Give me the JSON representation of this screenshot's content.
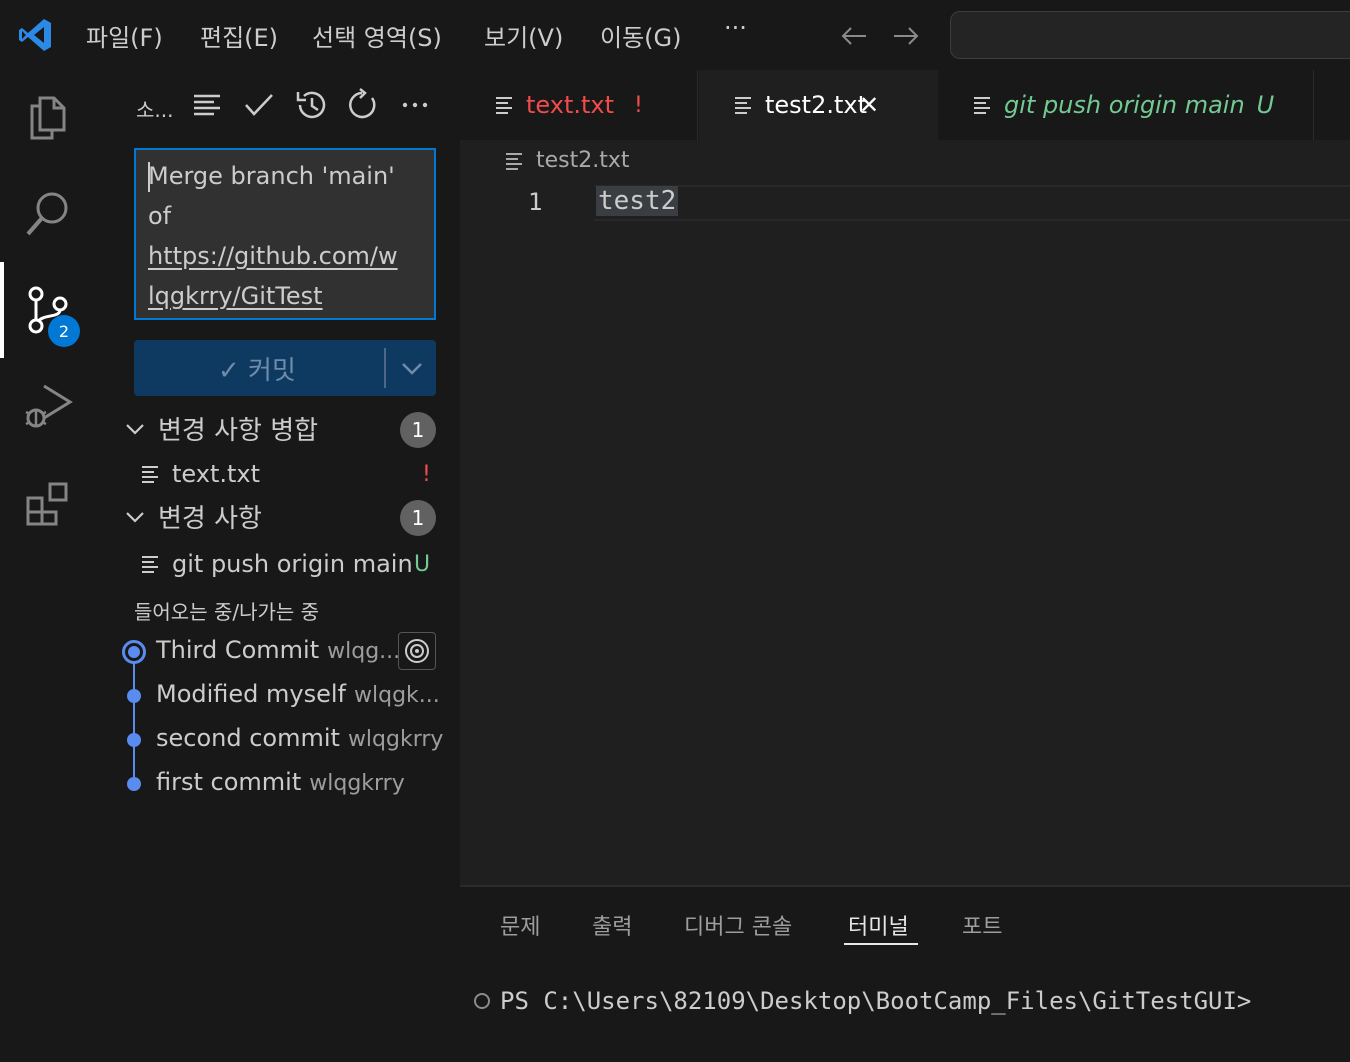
{
  "menu": {
    "items": [
      "파일(F)",
      "편집(E)",
      "선택 영역(S)",
      "보기(V)",
      "이동(G)"
    ],
    "more": "···"
  },
  "activity": {
    "scm_badge": "2"
  },
  "sidebar": {
    "title": "소...",
    "commit_message": {
      "line1": "Merge branch 'main'",
      "line2": "of",
      "line3": "https://github.com/w",
      "line4": "lqgkrry/GitTest"
    },
    "commit_button": "✓ 커밋",
    "merge_changes": {
      "label": "변경 사항 병합",
      "count": "1",
      "file": "text.txt",
      "status": "!"
    },
    "changes": {
      "label": "변경 사항",
      "count": "1",
      "file": "git push origin main",
      "status": "U"
    },
    "graph": {
      "title": "들어오는 중/나가는 중",
      "commits": [
        {
          "message": "Third Commit",
          "author": "wlqg..."
        },
        {
          "message": "Modified myself",
          "author": "wlqgk..."
        },
        {
          "message": "second commit",
          "author": "wlqgkrry"
        },
        {
          "message": "first commit",
          "author": "wlqgkrry"
        }
      ]
    }
  },
  "tabs": [
    {
      "label": "text.txt",
      "status": "!"
    },
    {
      "label": "test2.txt",
      "close": "✕"
    },
    {
      "label": "git push origin main",
      "status": "U"
    }
  ],
  "editor": {
    "breadcrumb": "test2.txt",
    "line_number": "1",
    "code": "test2"
  },
  "panel": {
    "tabs": [
      "문제",
      "출력",
      "디버그 콘솔",
      "터미널",
      "포트"
    ],
    "terminal_prompt": "PS C:\\Users\\82109\\Desktop\\BootCamp_Files\\GitTestGUI>"
  },
  "colors": {
    "accent": "#0078d4",
    "conflict": "#f14c4c",
    "untracked": "#73c991",
    "graph": "#5a8cf0"
  }
}
